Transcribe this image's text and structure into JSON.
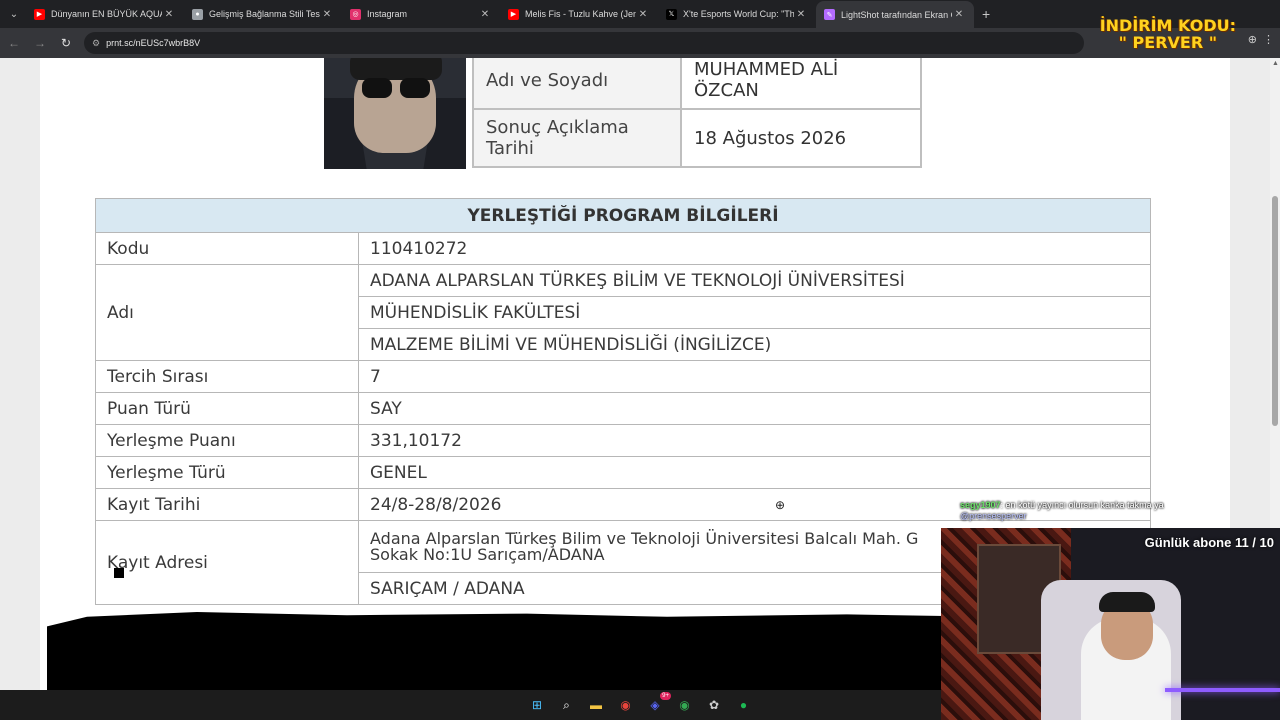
{
  "browser": {
    "tabs": [
      {
        "title": "Dünyanın EN BÜYÜK AQUAPARK",
        "favicon": "youtube-icon",
        "color": "#ff0000",
        "active": false
      },
      {
        "title": "Gelişmiş Bağlanma Stili Testi",
        "favicon": "globe-icon",
        "color": "#9aa0a6",
        "active": false
      },
      {
        "title": "Instagram",
        "favicon": "instagram-icon",
        "color": "#e1306c",
        "active": false
      },
      {
        "title": "Melis Fis - Tuzlu Kahve (Jenerik)",
        "favicon": "youtube-icon",
        "color": "#ff0000",
        "active": false
      },
      {
        "title": "X'te Esports World Cup: \"The la",
        "favicon": "x-icon",
        "color": "#ffffff",
        "active": false
      },
      {
        "title": "LightShot tarafından Ekran Gör",
        "favicon": "lightshot-icon",
        "color": "#b36bff",
        "active": true
      }
    ],
    "url": "prnt.sc/nEUSc7wbrB8V",
    "close_glyph": "✕",
    "new_tab_glyph": "+"
  },
  "overlay": {
    "promo_line1": "İNDİRİM KODU:",
    "promo_line2": "\" PERVER \""
  },
  "document": {
    "info_rows": [
      {
        "label": "Adı ve Soyadı",
        "value": "MUHAMMED ALİ ÖZCAN"
      },
      {
        "label": "Sonuç Açıklama Tarihi",
        "value": "18 Ağustos 2026"
      }
    ],
    "program": {
      "heading": "YERLEŞTİĞİ PROGRAM BİLGİLERİ",
      "code_label": "Kodu",
      "code_value": "110410272",
      "name_label": "Adı",
      "name_lines": [
        "ADANA ALPARSLAN TÜRKEŞ BİLİM VE TEKNOLOJİ ÜNİVERSİTESİ",
        "MÜHENDİSLİK FAKÜLTESİ",
        "MALZEME BİLİMİ VE MÜHENDİSLİĞİ (İNGİLİZCE)"
      ],
      "rows": [
        {
          "label": "Tercih Sırası",
          "value": "7"
        },
        {
          "label": "Puan Türü",
          "value": "SAY"
        },
        {
          "label": "Yerleşme Puanı",
          "value": "331,10172"
        },
        {
          "label": "Yerleşme Türü",
          "value": "GENEL"
        },
        {
          "label": "Kayıt Tarihi",
          "value": "24/8-28/8/2026"
        }
      ],
      "address_label": "Kayıt Adresi",
      "address_line1": "Adana Alparslan Türkeş Bilim ve Teknoloji Üniversitesi Balcalı Mah. G",
      "address_line2": "Sokak No:1U Sarıçam/ADANA",
      "address_city": "SARIÇAM / ADANA"
    }
  },
  "stream": {
    "chat_user": "segy1907",
    "chat_message": ": en kötü yayıncı olursun kanka takma ya",
    "chat_mention": "@prensesperver",
    "subscriber_goal": "Günlük abone 11 / 10"
  },
  "taskbar": {
    "apps": [
      "windows-start-icon",
      "search-icon",
      "file-explorer-icon",
      "chrome-icon",
      "discord-icon",
      "chrome-profile-icon",
      "settings-icon",
      "spotify-icon"
    ],
    "discord_badge": "9+"
  }
}
